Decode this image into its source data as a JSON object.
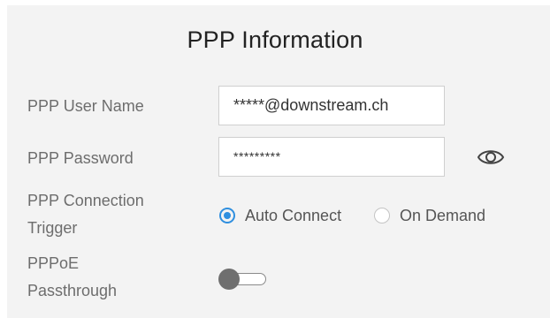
{
  "title": "PPP Information",
  "fields": {
    "username": {
      "label": "PPP User Name",
      "value": "*****@downstream.ch"
    },
    "password": {
      "label": "PPP Password",
      "value": "*********",
      "reveal_icon": "eye-icon"
    },
    "trigger": {
      "label_line1": "PPP Connection",
      "label_line2": "Trigger",
      "options": [
        {
          "label": "Auto Connect",
          "selected": true
        },
        {
          "label": "On Demand",
          "selected": false
        }
      ]
    },
    "passthrough": {
      "label_line1": "PPPoE",
      "label_line2": "Passthrough",
      "enabled": false
    }
  },
  "colors": {
    "accent": "#2f8fdf",
    "panel_bg": "#f3f3f3",
    "label_text": "#6d6d6d",
    "toggle_off": "#6f6f6f"
  }
}
